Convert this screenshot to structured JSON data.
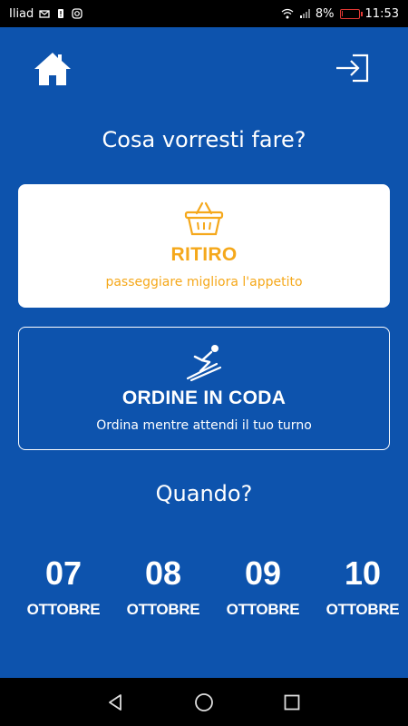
{
  "status_bar": {
    "carrier": "Iliad",
    "battery": "8%",
    "battery_level": 0.08,
    "time": "11:53"
  },
  "header": {
    "home_icon": "home-icon",
    "logout_icon": "logout-icon"
  },
  "question": "Cosa vorresti fare?",
  "options": [
    {
      "title": "RITIRO",
      "subtitle": "passeggiare migliora l'appetito",
      "icon": "basket-icon",
      "color": "#f5a81b"
    },
    {
      "title": "ORDINE IN CODA",
      "subtitle": "Ordina mentre attendi il tuo turno",
      "icon": "ski-jumper-icon",
      "color": "#ffffff"
    }
  ],
  "when_label": "Quando?",
  "dates": [
    {
      "day": "07",
      "month": "OTTOBRE"
    },
    {
      "day": "08",
      "month": "OTTOBRE"
    },
    {
      "day": "09",
      "month": "OTTOBRE"
    },
    {
      "day": "10",
      "month": "OTTOBRE"
    }
  ],
  "colors": {
    "background": "#0d53ad",
    "accent": "#f5a81b"
  }
}
